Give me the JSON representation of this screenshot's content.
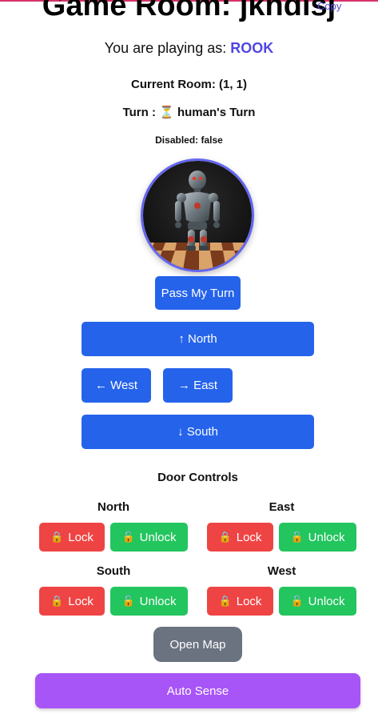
{
  "header": {
    "title": "Game Room: jkhdlsj",
    "copy_label": "Copy",
    "playing_prefix": "You are playing as:",
    "role": "ROOK"
  },
  "status": {
    "current_room": "Current Room: (1, 1)",
    "turn_prefix": "Turn :",
    "turn_icon": "⏳",
    "turn_text": "human's Turn",
    "disabled": "Disabled: false"
  },
  "avatar": {
    "description": "robot-on-chessboard"
  },
  "actions": {
    "pass_turn": "Pass My Turn",
    "north": "↑ North",
    "west": "← West",
    "east": "→ East",
    "south": "↓ South"
  },
  "doors": {
    "heading": "Door Controls",
    "lock_label": "Lock",
    "unlock_label": "Unlock",
    "lock_icon": "🔒",
    "unlock_icon": "🔓",
    "items": [
      {
        "name": "North"
      },
      {
        "name": "East"
      },
      {
        "name": "South"
      },
      {
        "name": "West"
      }
    ]
  },
  "footer": {
    "open_map": "Open Map",
    "auto_sense": "Auto Sense"
  },
  "colors": {
    "primary": "#2563eb",
    "lock": "#ef4444",
    "unlock": "#22c55e",
    "map": "#6b7280",
    "sense": "#a855f7",
    "role": "#4f46e5",
    "avatar_ring": "#6366f1"
  }
}
